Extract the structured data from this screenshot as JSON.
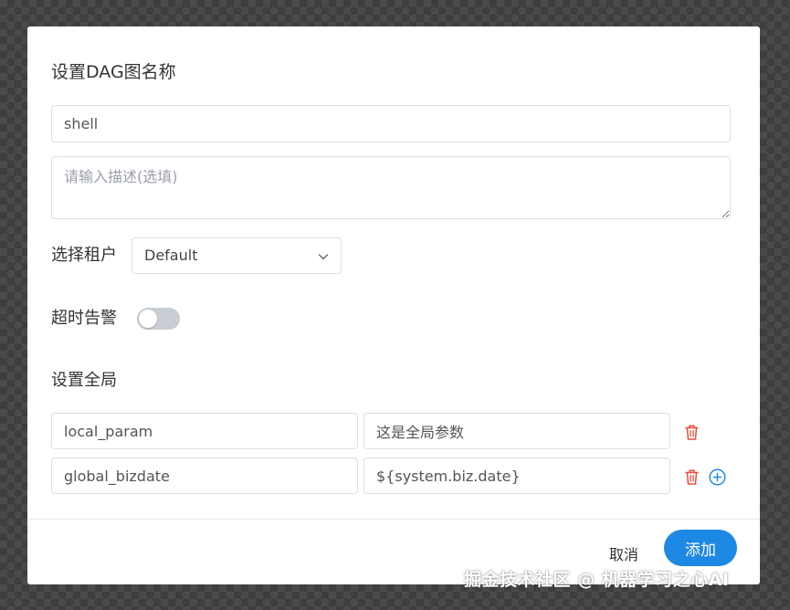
{
  "modal": {
    "title": "设置DAG图名称",
    "name_value": "shell",
    "description_placeholder": "请输入描述(选填)",
    "tenant_label": "选择租户",
    "tenant_selected": "Default",
    "timeout_label": "超时告警",
    "timeout_enabled": false,
    "global_label": "设置全局",
    "global_params": [
      {
        "key": "local_param",
        "value": "这是全局参数"
      },
      {
        "key": "global_bizdate",
        "value": "${system.biz.date}"
      }
    ],
    "cancel_label": "取消",
    "add_label": "添加"
  },
  "colors": {
    "primary": "#1e88e5",
    "danger": "#e74c3c",
    "toggle_off": "#c9cdd4"
  },
  "icons": {
    "select_caret": "chevron-down-icon",
    "delete": "trash-icon",
    "add": "plus-circle-icon"
  },
  "watermark": "掘金技术社区 @ 机器学习之心AI"
}
